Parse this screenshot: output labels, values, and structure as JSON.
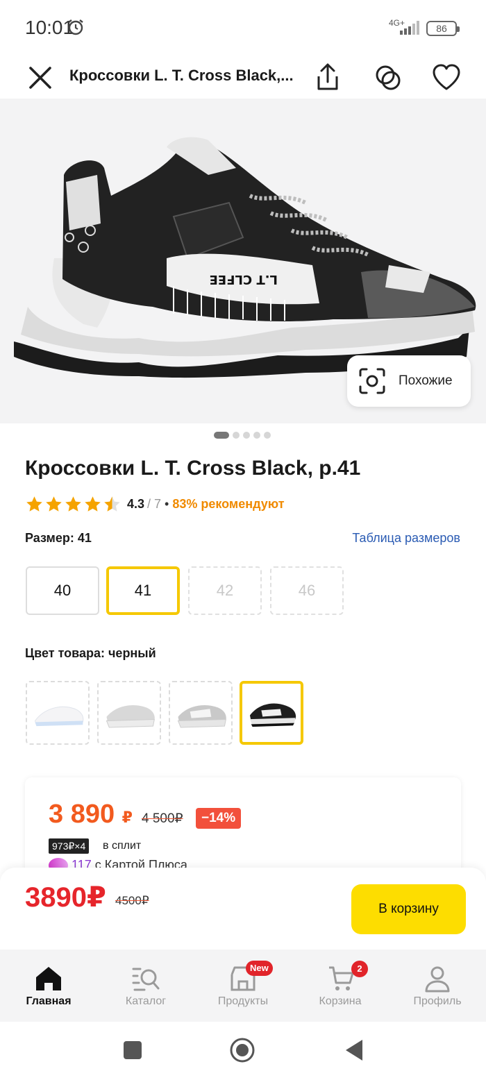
{
  "status_bar": {
    "time": "10:01",
    "network": "4G+",
    "battery": "86"
  },
  "header": {
    "title": "Кроссовки L. T. Cross Black,...",
    "icons": [
      "close-icon",
      "share-icon",
      "compare-icon",
      "heart-icon"
    ]
  },
  "gallery": {
    "similar_label": "Похожие",
    "image_count": 5,
    "active_index": 0
  },
  "product": {
    "title": "Кроссовки L. T. Cross Black, p.41",
    "rating": {
      "value": "4.3",
      "count": "/ 7",
      "separator": "•",
      "recommend": "83% рекомендуют",
      "stars": 4.3
    },
    "size_label": "Размер: 41",
    "size_table_link": "Таблица размеров",
    "sizes": [
      {
        "label": "40",
        "state": "available"
      },
      {
        "label": "41",
        "state": "selected"
      },
      {
        "label": "42",
        "state": "unavailable"
      },
      {
        "label": "46",
        "state": "unavailable"
      }
    ],
    "color_label": "Цвет товара: черный",
    "colors": [
      "white",
      "grey",
      "grey-white",
      "black"
    ]
  },
  "price_card": {
    "price": "3 890",
    "currency": "₽",
    "old_price": "4 500₽",
    "discount": "−14%",
    "split_badge": "973₽×4",
    "split_text": "в сплит",
    "plus_points": "117",
    "plus_text": "с Картой Плюса"
  },
  "buy_bar": {
    "price": "3890₽",
    "old_price": "4500₽",
    "button": "В корзину"
  },
  "bottom_nav": {
    "items": [
      {
        "label": "Главная",
        "icon": "home-icon",
        "active": true
      },
      {
        "label": "Каталог",
        "icon": "catalog-search-icon",
        "active": false
      },
      {
        "label": "Продукты",
        "icon": "store-icon",
        "badge": "New",
        "active": false
      },
      {
        "label": "Корзина",
        "icon": "cart-icon",
        "badge": "2",
        "active": false
      },
      {
        "label": "Профиль",
        "icon": "profile-icon",
        "active": false
      }
    ]
  },
  "colors": {
    "accent_yellow": "#fddd00",
    "price_orange": "#f25a1e",
    "price_red": "#e6252b",
    "link_blue": "#2a5bb3",
    "rating_orange": "#f08a00"
  }
}
